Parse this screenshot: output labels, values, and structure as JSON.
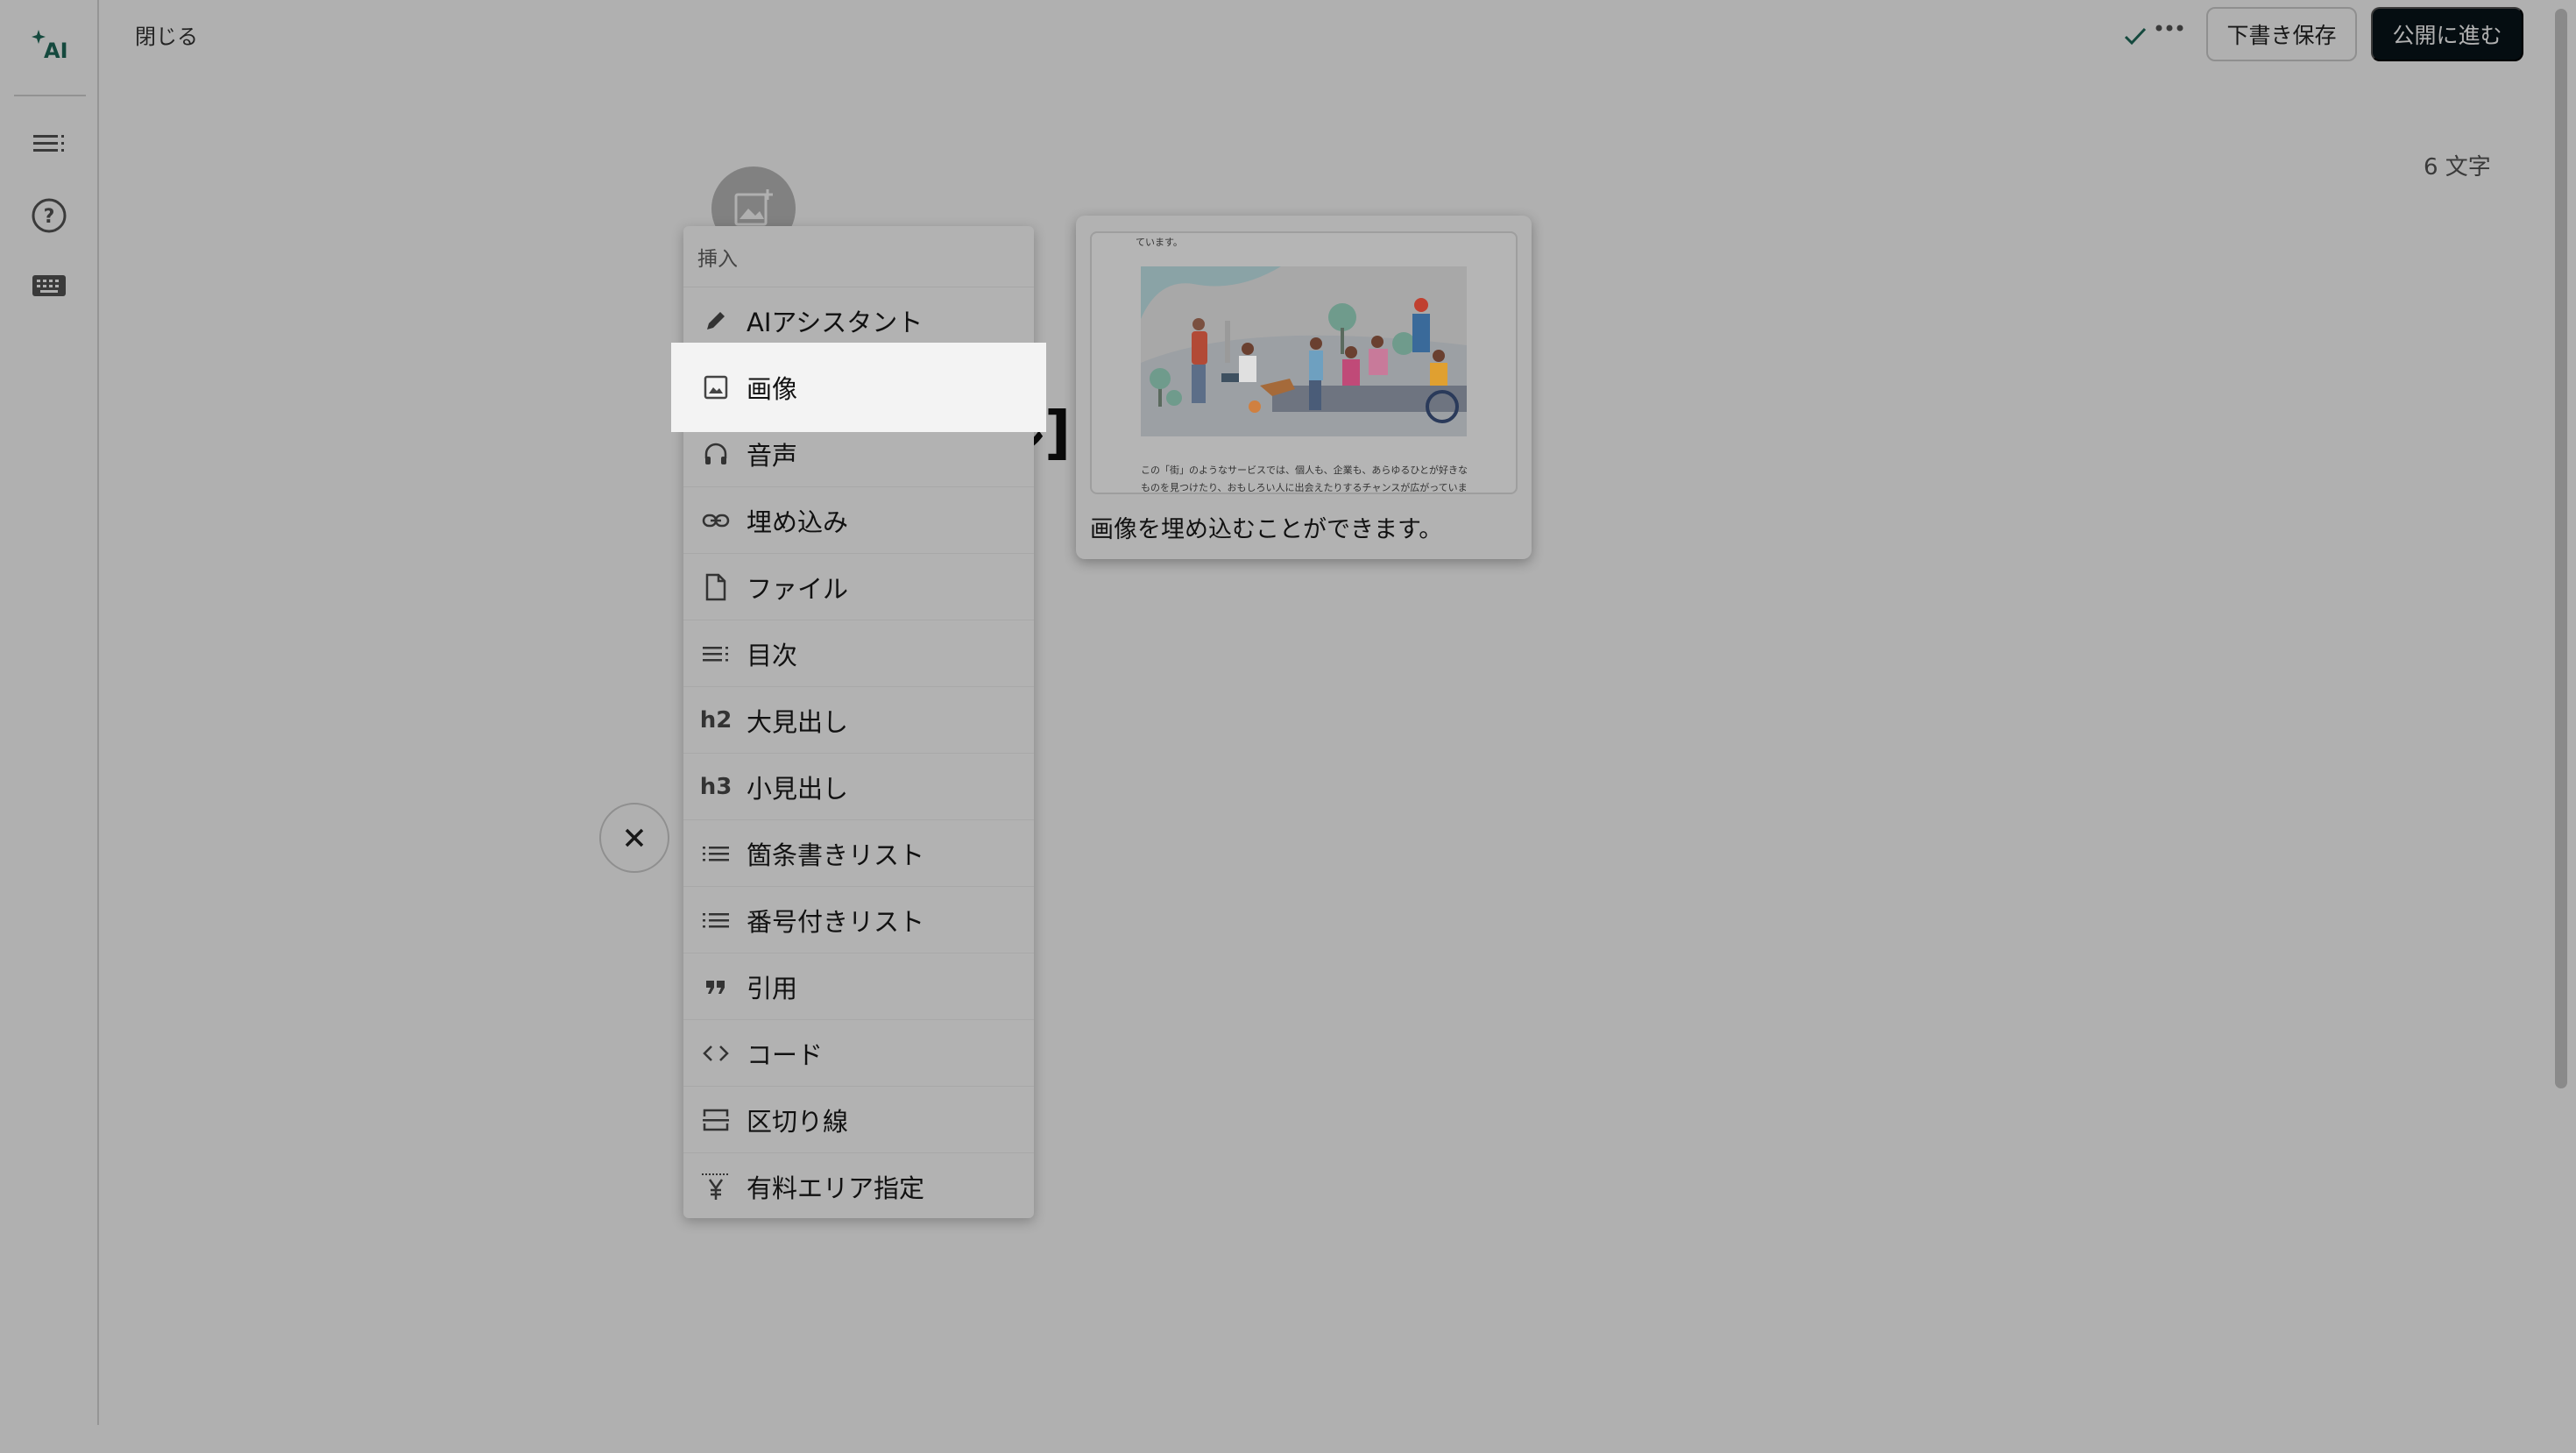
{
  "header": {
    "close_label": "閉じる",
    "draft_label": "下書き保存",
    "publish_label": "公開に進む",
    "char_count": "6 文字"
  },
  "sidebar": {
    "ai_label": "AI",
    "items": [
      {
        "icon": "table-of-contents-icon"
      },
      {
        "icon": "help-icon"
      },
      {
        "icon": "keyboard-icon"
      }
    ]
  },
  "editor": {
    "title_fragment": "ル]"
  },
  "menu": {
    "header": "挿入",
    "items": [
      {
        "label": "AIアシスタント",
        "icon": "pencil-icon"
      },
      {
        "label": "画像",
        "icon": "image-icon"
      },
      {
        "label": "音声",
        "icon": "headphones-icon"
      },
      {
        "label": "埋め込み",
        "icon": "link-icon"
      },
      {
        "label": "ファイル",
        "icon": "file-icon"
      },
      {
        "label": "目次",
        "icon": "toc-icon"
      },
      {
        "label": "大見出し",
        "icon": "h2-icon",
        "glyph": "h2"
      },
      {
        "label": "小見出し",
        "icon": "h3-icon",
        "glyph": "h3"
      },
      {
        "label": "箇条書きリスト",
        "icon": "bullet-list-icon"
      },
      {
        "label": "番号付きリスト",
        "icon": "numbered-list-icon"
      },
      {
        "label": "引用",
        "icon": "quote-icon"
      },
      {
        "label": "コード",
        "icon": "code-icon"
      },
      {
        "label": "区切り線",
        "icon": "divider-icon"
      },
      {
        "label": "有料エリア指定",
        "icon": "paid-area-icon"
      }
    ]
  },
  "preview": {
    "caption": "画像を埋め込むことができます。",
    "sample_top": "ています。",
    "sample_line1": "この「街」のようなサービスでは、個人も、企業も、あらゆるひとが好きな",
    "sample_line2": "ものを見つけたり、おもしろい人に出会えたりするチャンスが広がっていま"
  },
  "colors": {
    "publish_bg": "#08131a",
    "overlay": "rgba(0,0,0,0.31)",
    "highlight": "#f3f3f3"
  }
}
